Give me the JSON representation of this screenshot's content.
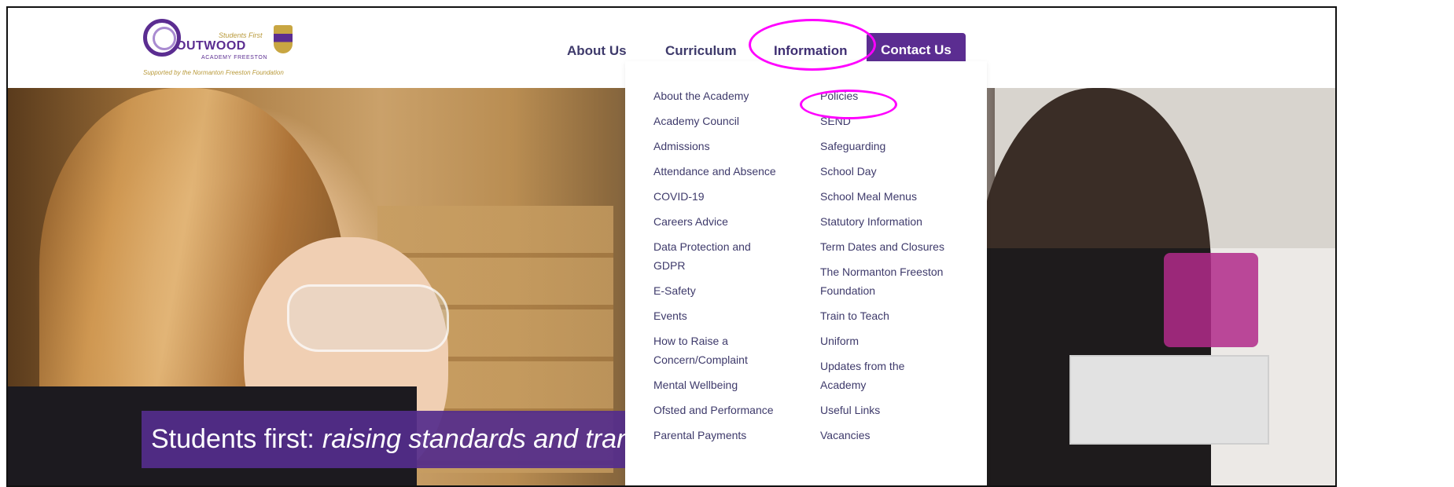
{
  "logo": {
    "tagline": "Students First",
    "name": "OUTWOOD",
    "sub": "ACADEMY FREESTON",
    "supported": "Supported by the Normanton Freeston Foundation"
  },
  "nav": {
    "about": "About Us",
    "curriculum": "Curriculum",
    "information": "Information",
    "contact": "Contact Us"
  },
  "dropdown": {
    "left": [
      "About the Academy",
      "Academy Council",
      "Admissions",
      "Attendance and Absence",
      "COVID-19",
      "Careers Advice",
      "Data Protection and GDPR",
      "E-Safety",
      "Events",
      "How to Raise a Concern/Complaint",
      "Mental Wellbeing",
      "Ofsted and Performance",
      "Parental Payments"
    ],
    "right": [
      "Policies",
      "SEND",
      "Safeguarding",
      "School Day",
      "School Meal Menus",
      "Statutory Information",
      "Term Dates and Closures",
      "The Normanton Freeston Foundation",
      "Train to Teach",
      "Uniform",
      "Updates from the Academy",
      "Useful Links",
      "Vacancies"
    ]
  },
  "hero": {
    "banner_lead": "Students first:",
    "banner_italic": "raising standards and trans"
  },
  "colors": {
    "brand_purple": "#5b2d91",
    "nav_text": "#3e3a6b",
    "annotation": "#ff00ff"
  }
}
